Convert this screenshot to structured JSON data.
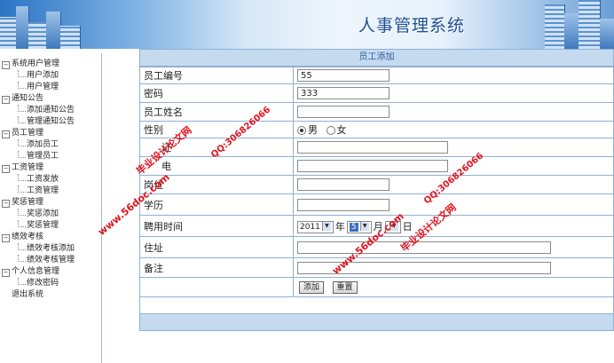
{
  "header": {
    "title": "人事管理系统"
  },
  "sidebar": {
    "groups": [
      {
        "label": "系统用户管理",
        "items": [
          "用户添加",
          "用户管理"
        ]
      },
      {
        "label": "通知公告",
        "items": [
          "添加通知公告",
          "管理通知公告"
        ]
      },
      {
        "label": "员工管理",
        "items": [
          "添加员工",
          "管理员工"
        ]
      },
      {
        "label": "工资管理",
        "items": [
          "工资发放",
          "工资管理"
        ]
      },
      {
        "label": "奖惩管理",
        "items": [
          "奖惩添加",
          "奖惩管理"
        ]
      },
      {
        "label": "绩效考核",
        "items": [
          "绩效考核添加",
          "绩效考核管理"
        ]
      },
      {
        "label": "个人信息管理",
        "items": [
          "修改密码"
        ]
      }
    ],
    "exit_label": "退出系统",
    "toggle_glyph": "−"
  },
  "form": {
    "title": "员工添加",
    "fields": {
      "employee_no": {
        "label": "员工编号",
        "value": "55"
      },
      "password": {
        "label": "密码",
        "value": "333"
      },
      "name": {
        "label": "员工姓名",
        "value": ""
      },
      "gender": {
        "label": "性别",
        "options": [
          "男",
          "女"
        ],
        "selected": "男"
      },
      "id_card": {
        "label": "证",
        "value": ""
      },
      "phone": {
        "label": "电",
        "value": ""
      },
      "position": {
        "label": "岗位",
        "value": ""
      },
      "education": {
        "label": "学历",
        "value": ""
      },
      "hire_date": {
        "label": "聘用时间",
        "year": "2011",
        "year_unit": "年",
        "month": "5",
        "month_unit": "月",
        "day": "",
        "day_unit": "日"
      },
      "address": {
        "label": "住址",
        "value": ""
      },
      "remark": {
        "label": "备注",
        "value": ""
      }
    },
    "buttons": {
      "add": "添加",
      "reset": "重置"
    }
  },
  "watermarks": {
    "site": "www.56doc.com",
    "qq": "QQ:306826066",
    "brand": "毕业设计论文网"
  },
  "colors": {
    "accent": "#2c5d9a",
    "panel": "#c6daef",
    "watermark": "#e0141e"
  }
}
